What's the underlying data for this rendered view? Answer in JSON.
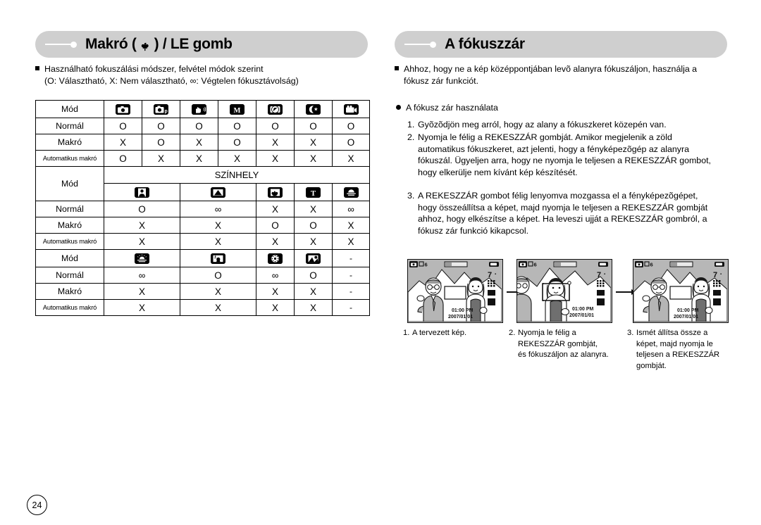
{
  "headers": {
    "left": {
      "prefix": "Makró (",
      "icon": "tulip-macro-icon",
      "suffix": ") / LE gomb"
    },
    "right": {
      "title": "A fókuszzár"
    }
  },
  "left_column": {
    "intro_line1": "Használható fokuszálási módszer, felvétel módok szerint",
    "intro_line2": "(O: Választható, X: Nem választható, ∞: Végtelen fókusztávolság)"
  },
  "table": {
    "row_labels": {
      "mode": "Mód",
      "normal": "Normál",
      "macro": "Makró",
      "auto_macro": "Automatikus makró"
    },
    "scene_header": "SZÍNHELY",
    "block1": {
      "icons": [
        "auto-camera-icon",
        "program-camera-icon",
        "anti-shake-icon",
        "manual-mode-icon",
        "scene-mode-icon",
        "night-mode-icon",
        "movie-clip-icon"
      ],
      "normal": [
        "O",
        "O",
        "O",
        "O",
        "O",
        "O",
        "O"
      ],
      "macro": [
        "X",
        "O",
        "X",
        "O",
        "X",
        "X",
        "O"
      ],
      "auto_macro": [
        "O",
        "X",
        "X",
        "X",
        "X",
        "X",
        "X"
      ]
    },
    "block2": {
      "icons": [
        "portrait-icon",
        "landscape-icon",
        "close-up-icon",
        "text-icon",
        "sunset-icon"
      ],
      "normal": [
        "O",
        "∞",
        "X",
        "X",
        "∞"
      ],
      "macro": [
        "X",
        "X",
        "O",
        "O",
        "X"
      ],
      "auto_macro": [
        "X",
        "X",
        "X",
        "X",
        "X"
      ]
    },
    "block3": {
      "icons": [
        "dawn-icon",
        "backlight-icon",
        "fireworks-icon",
        "beach-snow-icon",
        "none-icon"
      ],
      "normal": [
        "∞",
        "O",
        "∞",
        "O",
        "-"
      ],
      "macro": [
        "X",
        "X",
        "X",
        "X",
        "-"
      ],
      "auto_macro": [
        "X",
        "X",
        "X",
        "X",
        "-"
      ]
    }
  },
  "right_column": {
    "intro_line1": "Ahhoz, hogy ne a kép középpontjában levõ alanyra fókuszáljon, használja a",
    "intro_line2": "fókusz zár funkciót.",
    "usage_title": "A fókusz zár használata",
    "steps": [
      {
        "num": "1.",
        "lines": [
          "Gyõzõdjön meg arról, hogy az alany a fókuszkeret közepén van."
        ]
      },
      {
        "num": "2.",
        "lines": [
          "Nyomja le félig a REKESZZÁR gombját. Amikor megjelenik a zöld",
          "automatikus fókuszkeret, azt jelenti, hogy a fényképezõgép az alanyra",
          "fókuszál. Ügyeljen arra, hogy ne nyomja le teljesen a REKESZZÁR gombot,",
          "hogy elkerülje nem kívánt kép készítését."
        ]
      },
      {
        "num": "3.",
        "lines": [
          "A REKESZZÁR gombot félig lenyomva mozgassa el a fényképezõgépet,",
          "hogy összeállítsa a képet, majd nyomja le teljesen a REKESZZÁR gombját",
          "ahhoz, hogy elkészítse a képet. Ha leveszi ujját a REKESZZÁR gombról, a",
          "fókusz zár funkció kikapcsol."
        ]
      }
    ],
    "figures": [
      {
        "num": "1.",
        "caption_lines": [
          "A tervezett kép."
        ],
        "osd": {
          "frames": "6",
          "resolution": "7",
          "time": "01:00 PM",
          "date": "2007/01/01"
        }
      },
      {
        "num": "2.",
        "caption_lines": [
          "Nyomja le félig a",
          "REKESZZÁR gombját,",
          "és fókuszáljon az alanyra."
        ],
        "osd": {
          "frames": "6",
          "resolution": "7",
          "time": "01:00 PM",
          "date": "2007/01/01"
        }
      },
      {
        "num": "3.",
        "caption_lines": [
          "Ismét állítsa össze a",
          "képet, majd nyomja le",
          "teljesen a REKESZZÁR",
          "gombját."
        ],
        "osd": {
          "frames": "6",
          "resolution": "7",
          "time": "01:00 PM",
          "date": "2007/01/01"
        }
      }
    ]
  },
  "page_number": "24",
  "colors": {
    "pill_bg": "#cfcfcf",
    "lcd_sky": "#b7b7b7",
    "ink": "#000000"
  }
}
